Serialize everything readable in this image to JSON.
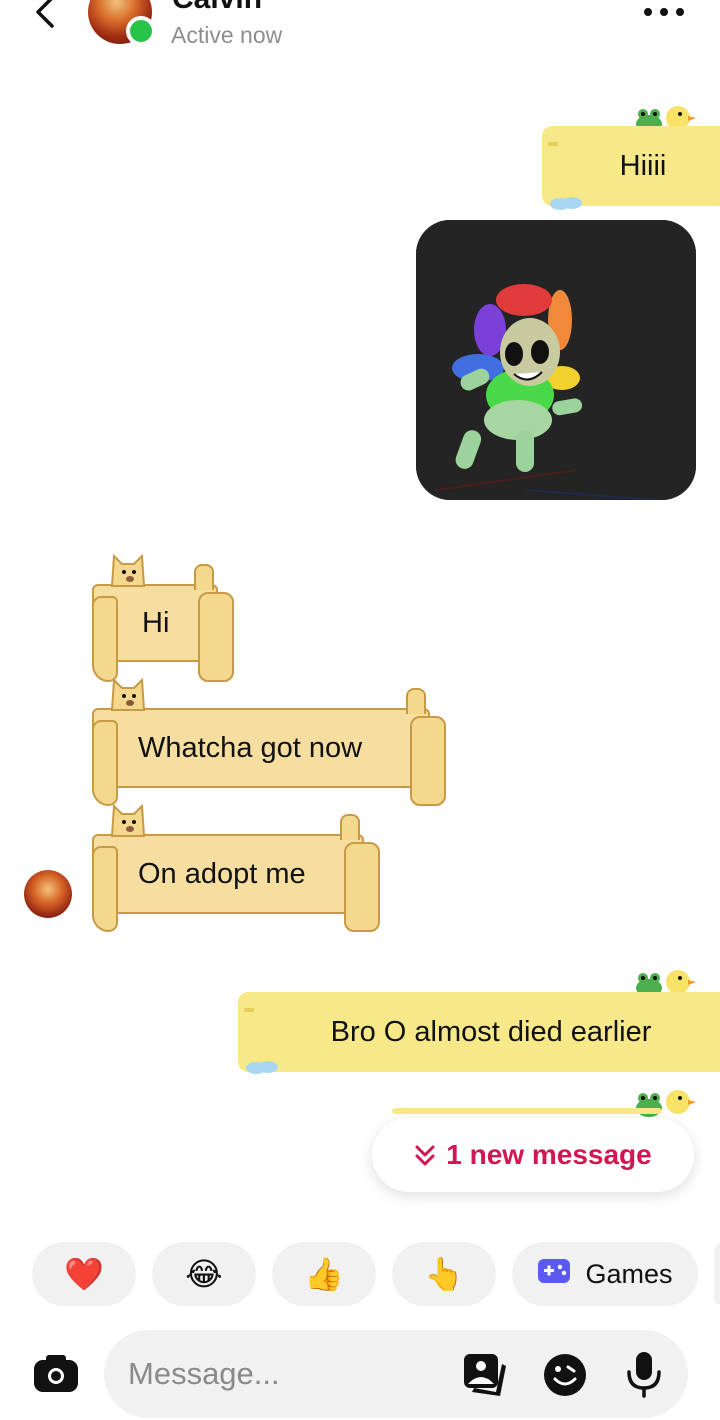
{
  "header": {
    "contact_name": "Calvin",
    "status": "Active now",
    "online_color": "#2ac34a"
  },
  "messages": [
    {
      "from": "me",
      "type": "text",
      "text": "Hiiii",
      "style": "duck-sticker-bubble"
    },
    {
      "from": "me",
      "type": "image",
      "subject": "colorful roblox character"
    },
    {
      "from": "contact",
      "type": "text",
      "text": "Hi",
      "style": "doge-sticker-bubble"
    },
    {
      "from": "contact",
      "type": "text",
      "text": "Whatcha got now",
      "style": "doge-sticker-bubble"
    },
    {
      "from": "contact",
      "type": "text",
      "text": "On adopt me",
      "style": "doge-sticker-bubble"
    },
    {
      "from": "me",
      "type": "text",
      "text": "Bro O almost died earlier",
      "style": "duck-sticker-bubble"
    }
  ],
  "new_message_pill": {
    "label": "1 new message",
    "color": "#d2164f"
  },
  "quick_reactions": {
    "heart": "❤️",
    "laugh": "😂",
    "thumbs_up": "👍",
    "point": "👆",
    "games_label": "Games"
  },
  "composer": {
    "placeholder": "Message..."
  },
  "icons": [
    "back-arrow-icon",
    "more-icon",
    "camera-icon",
    "gallery-icon",
    "sticker-icon",
    "microphone-icon",
    "games-controller-icon",
    "chevron-double-down-icon"
  ]
}
